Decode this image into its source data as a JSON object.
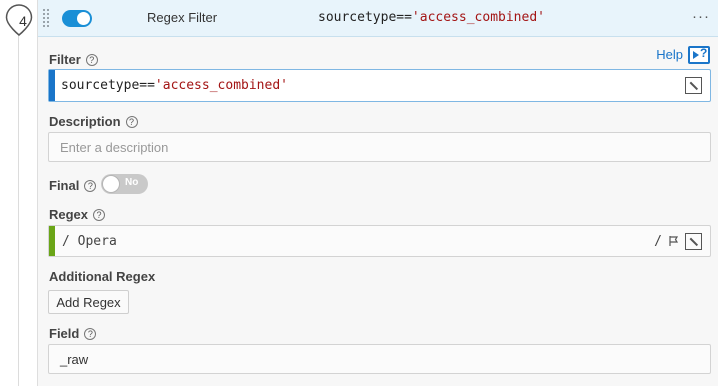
{
  "step": {
    "number": "4"
  },
  "header": {
    "function_name": "Regex Filter",
    "summary_prefix": "sourcetype==",
    "summary_string": "'access_combined'",
    "more_icon": "more-horizontal-icon",
    "enabled": true
  },
  "help": {
    "label": "Help",
    "icon": "help-panel-icon"
  },
  "filter": {
    "label": "Filter",
    "value_prefix": "sourcetype==",
    "value_string": "'access_combined'"
  },
  "description": {
    "label": "Description",
    "placeholder": "Enter a description",
    "value": ""
  },
  "final": {
    "label": "Final",
    "toggle_text": "No",
    "enabled": false
  },
  "regex": {
    "label": "Regex",
    "delim_start": "/",
    "value": "Opera",
    "delim_end": "/"
  },
  "additional_regex": {
    "label": "Additional Regex",
    "button_label": "Add Regex"
  },
  "field": {
    "label": "Field",
    "value": "_raw"
  },
  "colors": {
    "accent_blue": "#1a8fd6",
    "filter_bar": "#1a75c9",
    "regex_bar": "#6aa517",
    "header_bg": "#e8f4fb"
  }
}
